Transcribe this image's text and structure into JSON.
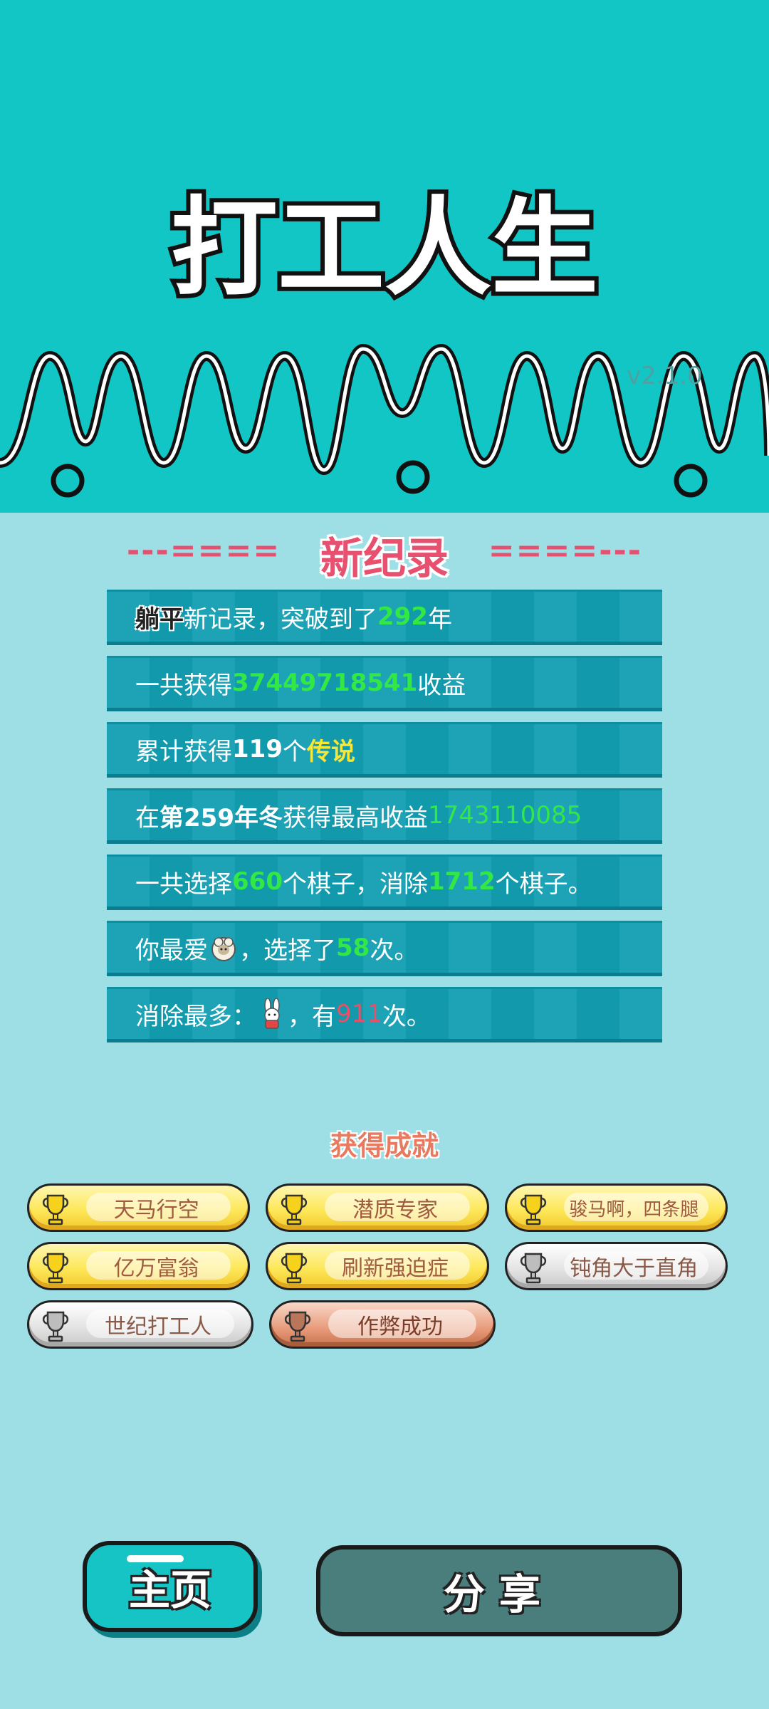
{
  "game": {
    "title": "打工人生",
    "version": "v2.1.0"
  },
  "records_header": {
    "dashes_left": "---====",
    "title": "新纪录",
    "dashes_right": "====---"
  },
  "records": {
    "r1": {
      "badge": "躺平",
      "text_a": "新记录，突破到了",
      "value": "292",
      "text_b": "年"
    },
    "r2": {
      "text_a": "一共获得",
      "value": "37449718541",
      "text_b": "收益"
    },
    "r3": {
      "text_a": "累计获得",
      "value": "119",
      "text_b": "个",
      "tier": "传说"
    },
    "r4": {
      "text_a": "在 ",
      "season": "第259年冬",
      "text_b": " 获得最高收益",
      "value": "1743110085"
    },
    "r5": {
      "text_a": "一共选择",
      "value_a": "660",
      "text_b": "个棋子，消除",
      "value_b": "1712",
      "text_c": "个棋子。"
    },
    "r6": {
      "text_a": "你最爱",
      "icon": "sheep-icon",
      "text_b": "，选择了",
      "value": "58",
      "text_c": "次。"
    },
    "r7": {
      "text_a": "消除最多：",
      "icon": "rabbit-icon",
      "text_b": "，有",
      "value": "911",
      "text_c": "次。"
    }
  },
  "achievements": {
    "title": "获得成就",
    "items": [
      {
        "label": "天马行空",
        "tier": "gold"
      },
      {
        "label": "潜质专家",
        "tier": "gold"
      },
      {
        "label": "骏马啊，四条腿",
        "tier": "gold"
      },
      {
        "label": "亿万富翁",
        "tier": "gold"
      },
      {
        "label": "刷新强迫症",
        "tier": "gold"
      },
      {
        "label": "钝角大于直角",
        "tier": "silver"
      },
      {
        "label": "世纪打工人",
        "tier": "silver"
      },
      {
        "label": "作弊成功",
        "tier": "bronze"
      }
    ]
  },
  "buttons": {
    "home": "主页",
    "share": "分享"
  },
  "colors": {
    "top_band": "#13c6c6",
    "background": "#9edfe5",
    "row": "#129eb2",
    "highlight_green": "#32e845",
    "highlight_yellow": "#f5e63a",
    "highlight_red": "#e8506a",
    "header_red": "#e85070"
  }
}
